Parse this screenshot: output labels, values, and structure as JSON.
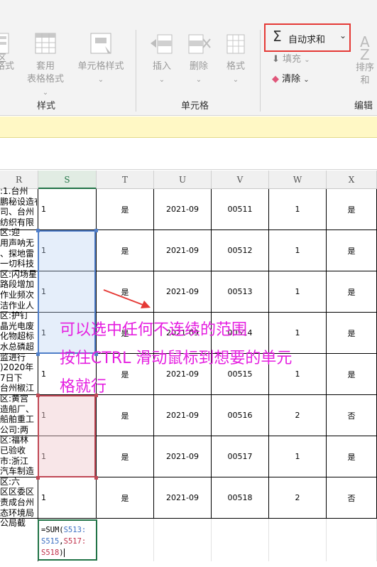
{
  "ribbon": {
    "left_cut": [
      "格式",
      "区"
    ],
    "cell_styles_group": {
      "label": "样式",
      "buttons": [
        {
          "label1": "套用",
          "label2": "表格格式"
        },
        {
          "label1": "单元格样式",
          "label2": ""
        }
      ]
    },
    "cells_group": {
      "label": "单元格",
      "buttons": [
        {
          "label": "插入"
        },
        {
          "label": "删除"
        },
        {
          "label": "格式"
        }
      ]
    },
    "editing_group": {
      "label": "编辑",
      "autosum": "自动求和",
      "fill": "填充",
      "clear": "清除",
      "sort_cut": "排序和"
    }
  },
  "columns": [
    "R",
    "S",
    "T",
    "U",
    "V",
    "W",
    "X"
  ],
  "r_column_text": [
    ":1.台州",
    "鹏秘设造有",
    "司、台州",
    "纺织有限",
    "区:迎",
    "用声呐无",
    "、探地雷",
    "一切科技",
    "区:闪场星",
    "路段增加",
    "作业频次",
    "洁作业人",
    "区:护钉",
    "晶光电废",
    "化物超标",
    "水总磷超",
    "监进行",
    ")2020年",
    "7日下",
    "台州椒江",
    "区:黄宫",
    "造船厂、",
    "船舶重工",
    "公司:两",
    "区:福林",
    "已验收",
    "市:浙江",
    "汽车制造",
    "区:六",
    "区区委区",
    "责成台州",
    "态环境局",
    "公局截"
  ],
  "rows": [
    {
      "S": "1",
      "T": "是",
      "U": "2021-09",
      "V": "00511",
      "W": "1",
      "X": "是"
    },
    {
      "S": "1",
      "T": "是",
      "U": "2021-09",
      "V": "00512",
      "W": "1",
      "X": "是"
    },
    {
      "S": "1",
      "T": "是",
      "U": "2021-09",
      "V": "00513",
      "W": "1",
      "X": "是"
    },
    {
      "S": "1",
      "T": "是",
      "U": "2021-09",
      "V": "00514",
      "W": "1",
      "X": "是"
    },
    {
      "S": "1",
      "T": "是",
      "U": "2021-09",
      "V": "00515",
      "W": "1",
      "X": "是"
    },
    {
      "S": "1",
      "T": "是",
      "U": "2021-09",
      "V": "00516",
      "W": "2",
      "X": "否"
    },
    {
      "S": "1",
      "T": "是",
      "U": "2021-09",
      "V": "00517",
      "W": "1",
      "X": "是"
    },
    {
      "S": "1",
      "T": "是",
      "U": "2021-09",
      "V": "00518",
      "W": "2",
      "X": "否"
    }
  ],
  "formula": {
    "prefix": "=SUM(",
    "ref1": "S513:",
    "ref2": "S515",
    "comma": ",",
    "ref3": "S517:",
    "ref4": "S518",
    "suffix": ")"
  },
  "annotation": {
    "line1": "可以选中任何不连续的范围",
    "line2": "按住CTRL 滑动鼠标到想要的单元",
    "line3": "格就行"
  },
  "colors": {
    "accent_green": "#217346",
    "annotation": "#e51ee0",
    "callout_border": "#e53935",
    "ref_blue": "#3b6fc2",
    "ref_red": "#c0304a"
  }
}
